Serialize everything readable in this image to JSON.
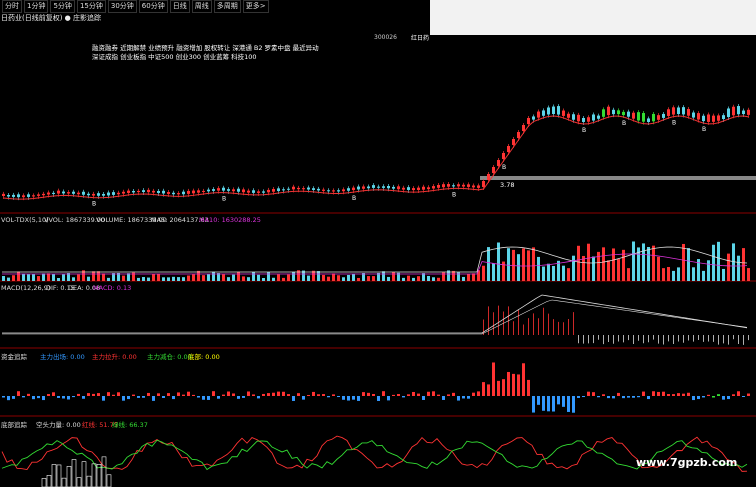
{
  "toolbar": {
    "tabs": [
      "分时",
      "1分钟",
      "5分钟",
      "15分钟",
      "30分钟",
      "60分钟",
      "日线",
      "周线",
      "多周期",
      "更多>"
    ]
  },
  "chart_title": "日药业(日线前复权) ● 庄影追踪",
  "stock_code": "300026",
  "red_tag": "红日药",
  "concept_tags": [
    "融资融券 近期解禁 业绩预升 融资增加 股权转让 深港通 B2 罗素中盘 最近异动",
    "深证成指 创业板指 中证500 创业300 创业蓝筹 科技100"
  ],
  "price_marker": "3.78",
  "signal_labels": [
    "B",
    "B",
    "B",
    "B",
    "B",
    "B",
    "B",
    "B",
    "B"
  ],
  "vol_panel": {
    "name": "VOL-TDX(5,10)",
    "vvol": "VVOL: 1867339.00",
    "volume": "VOLUME: 1867339.00",
    "ma5": "MA5: 2064137.63",
    "ma10": "MA10: 1630288.25"
  },
  "macd_panel": {
    "name": "MACD(12,26,9)",
    "dif": "DIF: 0.15",
    "dea": "DEA: 0.08",
    "macd": "MACD: 0.13"
  },
  "fund_panel": {
    "name": "资金追踪",
    "main_out": "主力出场: 0.00",
    "main_accel": "主力拉升: 0.00",
    "main_reduce": "主力减仓: 0.00",
    "bottom": "底部: 0.00"
  },
  "bottom_panel": {
    "name": "底部追踪",
    "empty_power": "空头力量: 0.00",
    "red_line": "红线: 51.75",
    "green_line": "绿线: 66.37"
  },
  "watermark": "www.7gpzb.com",
  "colors": {
    "up": "#ff3333",
    "down": "#5cd5e8",
    "green": "#33dd33",
    "white": "#dddddd",
    "magenta": "#dd33dd",
    "yellow": "#ffff00",
    "blue": "#3399ff",
    "grid": "#8b0000"
  }
}
